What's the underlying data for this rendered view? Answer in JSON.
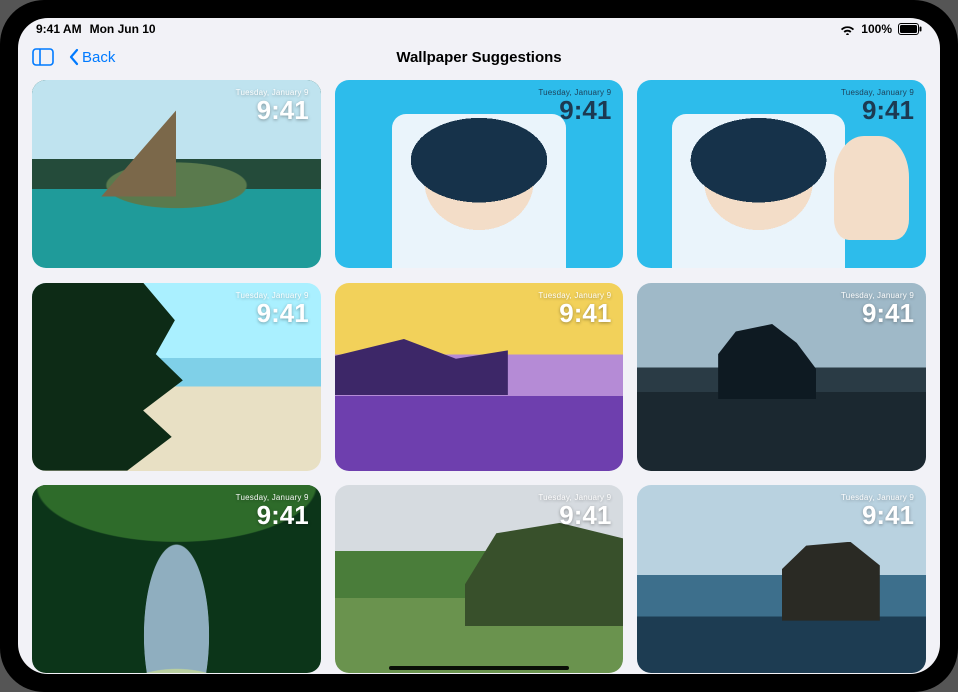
{
  "statusbar": {
    "time": "9:41 AM",
    "date": "Mon Jun 10",
    "battery_pct": "100%"
  },
  "nav": {
    "back_label": "Back",
    "title": "Wallpaper Suggestions"
  },
  "tile_overlay": {
    "date": "Tuesday, January 9",
    "time": "9:41"
  },
  "tiles": [
    {
      "id": "volcano-lagoon",
      "art": "art-volcano",
      "light": false
    },
    {
      "id": "portrait-bubble",
      "art": "art-portrait-a",
      "light": true
    },
    {
      "id": "portrait-selfie",
      "art": "art-portrait-b",
      "light": true
    },
    {
      "id": "jungle-cliff",
      "art": "art-cliff",
      "light": false
    },
    {
      "id": "duotone-beach",
      "art": "art-duotone",
      "light": false
    },
    {
      "id": "basalt-coast",
      "art": "art-basalt",
      "light": false
    },
    {
      "id": "rainforest-stream",
      "art": "art-stream",
      "light": false
    },
    {
      "id": "green-highlands",
      "art": "art-highlands",
      "light": false
    },
    {
      "id": "ocean-searock",
      "art": "art-searock",
      "light": false
    }
  ]
}
